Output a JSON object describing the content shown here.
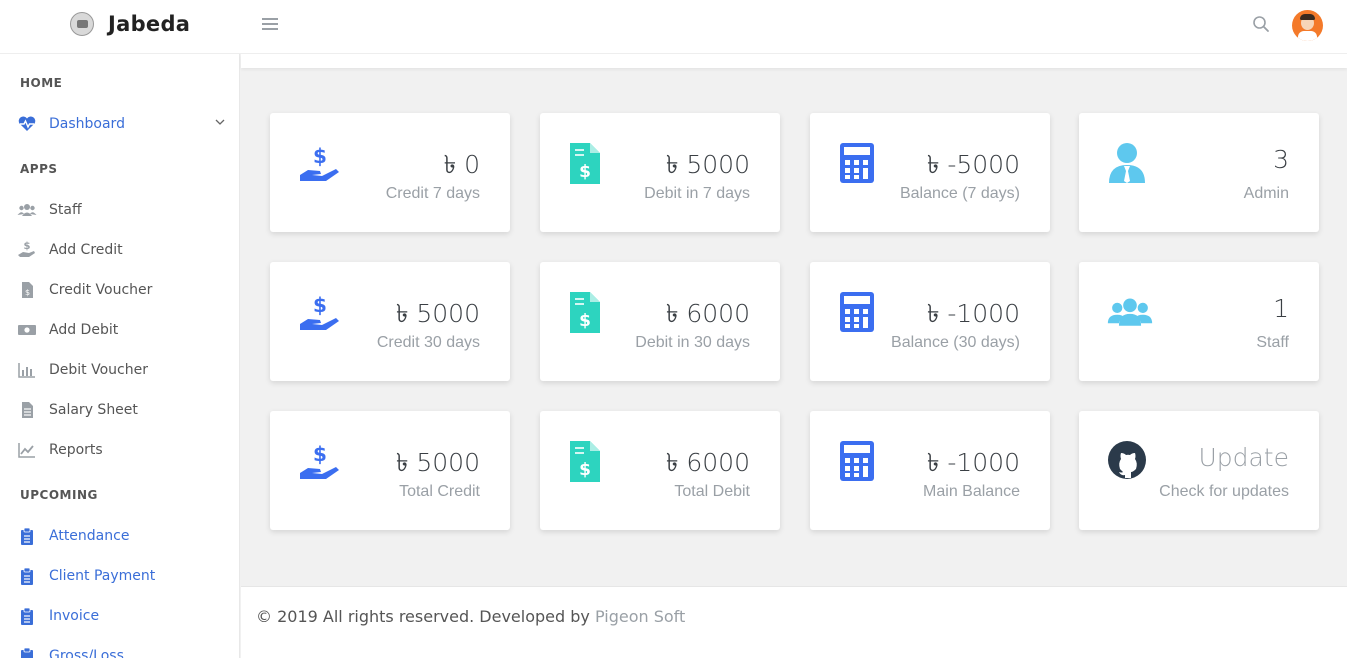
{
  "header": {
    "brand": "Jabeda"
  },
  "sidebar": {
    "sections": [
      {
        "heading": "HOME"
      },
      {
        "heading": "APPS"
      },
      {
        "heading": "UPCOMING"
      }
    ],
    "home_items": [
      {
        "label": "Dashboard",
        "icon": "heartbeat-icon"
      }
    ],
    "app_items": [
      {
        "label": "Staff",
        "icon": "users-icon"
      },
      {
        "label": "Add Credit",
        "icon": "hand-dollar-icon"
      },
      {
        "label": "Credit Voucher",
        "icon": "invoice-icon"
      },
      {
        "label": "Add Debit",
        "icon": "money-bill-icon"
      },
      {
        "label": "Debit Voucher",
        "icon": "bar-chart-icon"
      },
      {
        "label": "Salary Sheet",
        "icon": "document-icon"
      },
      {
        "label": "Reports",
        "icon": "line-chart-icon"
      }
    ],
    "upcoming_items": [
      {
        "label": "Attendance",
        "icon": "clipboard-icon"
      },
      {
        "label": "Client Payment",
        "icon": "clipboard-icon"
      },
      {
        "label": "Invoice",
        "icon": "clipboard-icon"
      },
      {
        "label": "Gross/Loss",
        "icon": "clipboard-icon"
      }
    ]
  },
  "cards": [
    {
      "value": "৳ 0",
      "caption": "Credit 7 days",
      "icon": "hand-dollar-icon"
    },
    {
      "value": "৳ 5000",
      "caption": "Debit in 7 days",
      "icon": "invoice-dollar-icon"
    },
    {
      "value": "৳ -5000",
      "caption": "Balance (7 days)",
      "icon": "calculator-icon"
    },
    {
      "value": "3",
      "caption": "Admin",
      "icon": "user-tie-icon"
    },
    {
      "value": "৳ 5000",
      "caption": "Credit 30 days",
      "icon": "hand-dollar-icon"
    },
    {
      "value": "৳ 6000",
      "caption": "Debit in 30 days",
      "icon": "invoice-dollar-icon"
    },
    {
      "value": "৳ -1000",
      "caption": "Balance (30 days)",
      "icon": "calculator-icon"
    },
    {
      "value": "1",
      "caption": "Staff",
      "icon": "users-icon"
    },
    {
      "value": "৳ 5000",
      "caption": "Total Credit",
      "icon": "hand-dollar-icon"
    },
    {
      "value": "৳ 6000",
      "caption": "Total Debit",
      "icon": "invoice-dollar-icon"
    },
    {
      "value": "৳ -1000",
      "caption": "Main Balance",
      "icon": "calculator-icon"
    },
    {
      "value": "Update",
      "caption": "Check for updates",
      "icon": "github-icon"
    }
  ],
  "footer": {
    "text": "© 2019 All rights reserved. Developed by ",
    "link": "Pigeon Soft"
  },
  "colors": {
    "accent_blue": "#3a6ed8",
    "teal": "#2dd4bf",
    "calc_blue": "#3b6ef0",
    "light_blue": "#5ec8ee",
    "muted": "#9aa0a6"
  }
}
